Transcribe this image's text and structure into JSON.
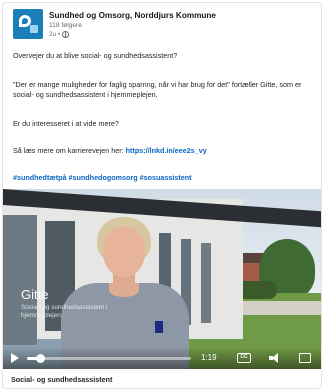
{
  "post": {
    "org_name": "Sundhed og Omsorg, Norddjurs Kommune",
    "followers": "118 følgere",
    "time": "2u •",
    "text1": "Overvejer du at blive social- og sundhedsassistent?",
    "text2": "\"Der er mange muligheder for faglig sparring, når vi har brug for det\" fortæller Gitte, som er social- og sundhedsassistent i hjemmeplejen.",
    "text3": "Er du interesseret i at vide mere?",
    "text4_prefix": "Så læs mere om karrierevejen her: ",
    "text4_link": "https://lnkd.in/eee2s_vy",
    "hashtags": "#sundhedtætpå #sundhedogomsorg #sosuassistent",
    "caption": "Social- og sundhedsassistent"
  },
  "video": {
    "overlay_name": "Gitte",
    "overlay_role": "Social- og sundhedsassistent i hjemmeplejen",
    "time": "1:19",
    "progress_fraction": 0.08,
    "cc_label": "CC",
    "icons": [
      "play-icon",
      "closed-captions-icon",
      "volume-icon",
      "fullscreen-icon"
    ]
  },
  "colors": {
    "link": "#0a66c2",
    "logo": "#1a7fb8"
  }
}
